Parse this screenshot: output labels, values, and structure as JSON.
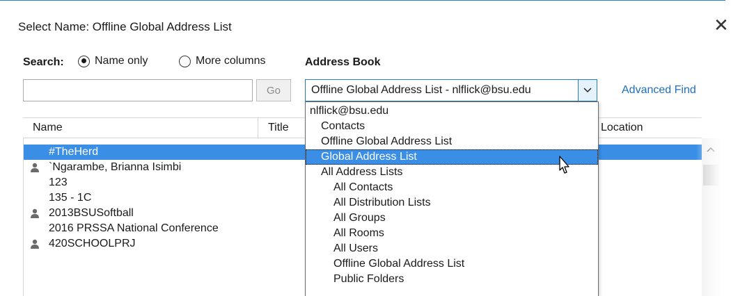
{
  "window": {
    "title": "Select Name: Offline Global Address List",
    "close_symbol": "✕"
  },
  "search": {
    "label": "Search:",
    "options": [
      {
        "label": "Name only",
        "checked": true
      },
      {
        "label": "More columns",
        "checked": false
      }
    ],
    "input_value": "",
    "go_label": "Go"
  },
  "address_book": {
    "label": "Address Book",
    "selected": "Offline Global Address List - nlflick@bsu.edu",
    "advanced_find": "Advanced Find"
  },
  "columns": [
    "Name",
    "Title",
    "Location"
  ],
  "rows": [
    {
      "name": "#TheHerd",
      "icon": "none",
      "selected": true
    },
    {
      "name": "`Ngarambe, Brianna Isimbi",
      "icon": "person-icon",
      "selected": false
    },
    {
      "name": "123",
      "icon": "none",
      "selected": false
    },
    {
      "name": "135 - 1C",
      "icon": "none",
      "selected": false
    },
    {
      "name": "2013BSUSoftball",
      "icon": "person-icon",
      "selected": false
    },
    {
      "name": "2016 PRSSA National Conference",
      "icon": "none",
      "selected": false
    },
    {
      "name": "420SCHOOLPRJ",
      "icon": "person-icon",
      "selected": false
    }
  ],
  "dropdown_items": [
    {
      "label": "nlflick@bsu.edu",
      "level": 0
    },
    {
      "label": "Contacts",
      "level": 1
    },
    {
      "label": "Offline Global Address List",
      "level": 1
    },
    {
      "label": "Global Address List",
      "level": 1,
      "hover": true
    },
    {
      "label": "All Address Lists",
      "level": 1
    },
    {
      "label": "All Contacts",
      "level": 2
    },
    {
      "label": "All Distribution Lists",
      "level": 2
    },
    {
      "label": "All Groups",
      "level": 2
    },
    {
      "label": "All Rooms",
      "level": 2
    },
    {
      "label": "All Users",
      "level": 2
    },
    {
      "label": "Offline Global Address List",
      "level": 2
    },
    {
      "label": "Public Folders",
      "level": 2
    }
  ],
  "colors": {
    "accent": "#3a8ee6",
    "link": "#1e6fbf",
    "border_focus": "#2b79c3"
  }
}
